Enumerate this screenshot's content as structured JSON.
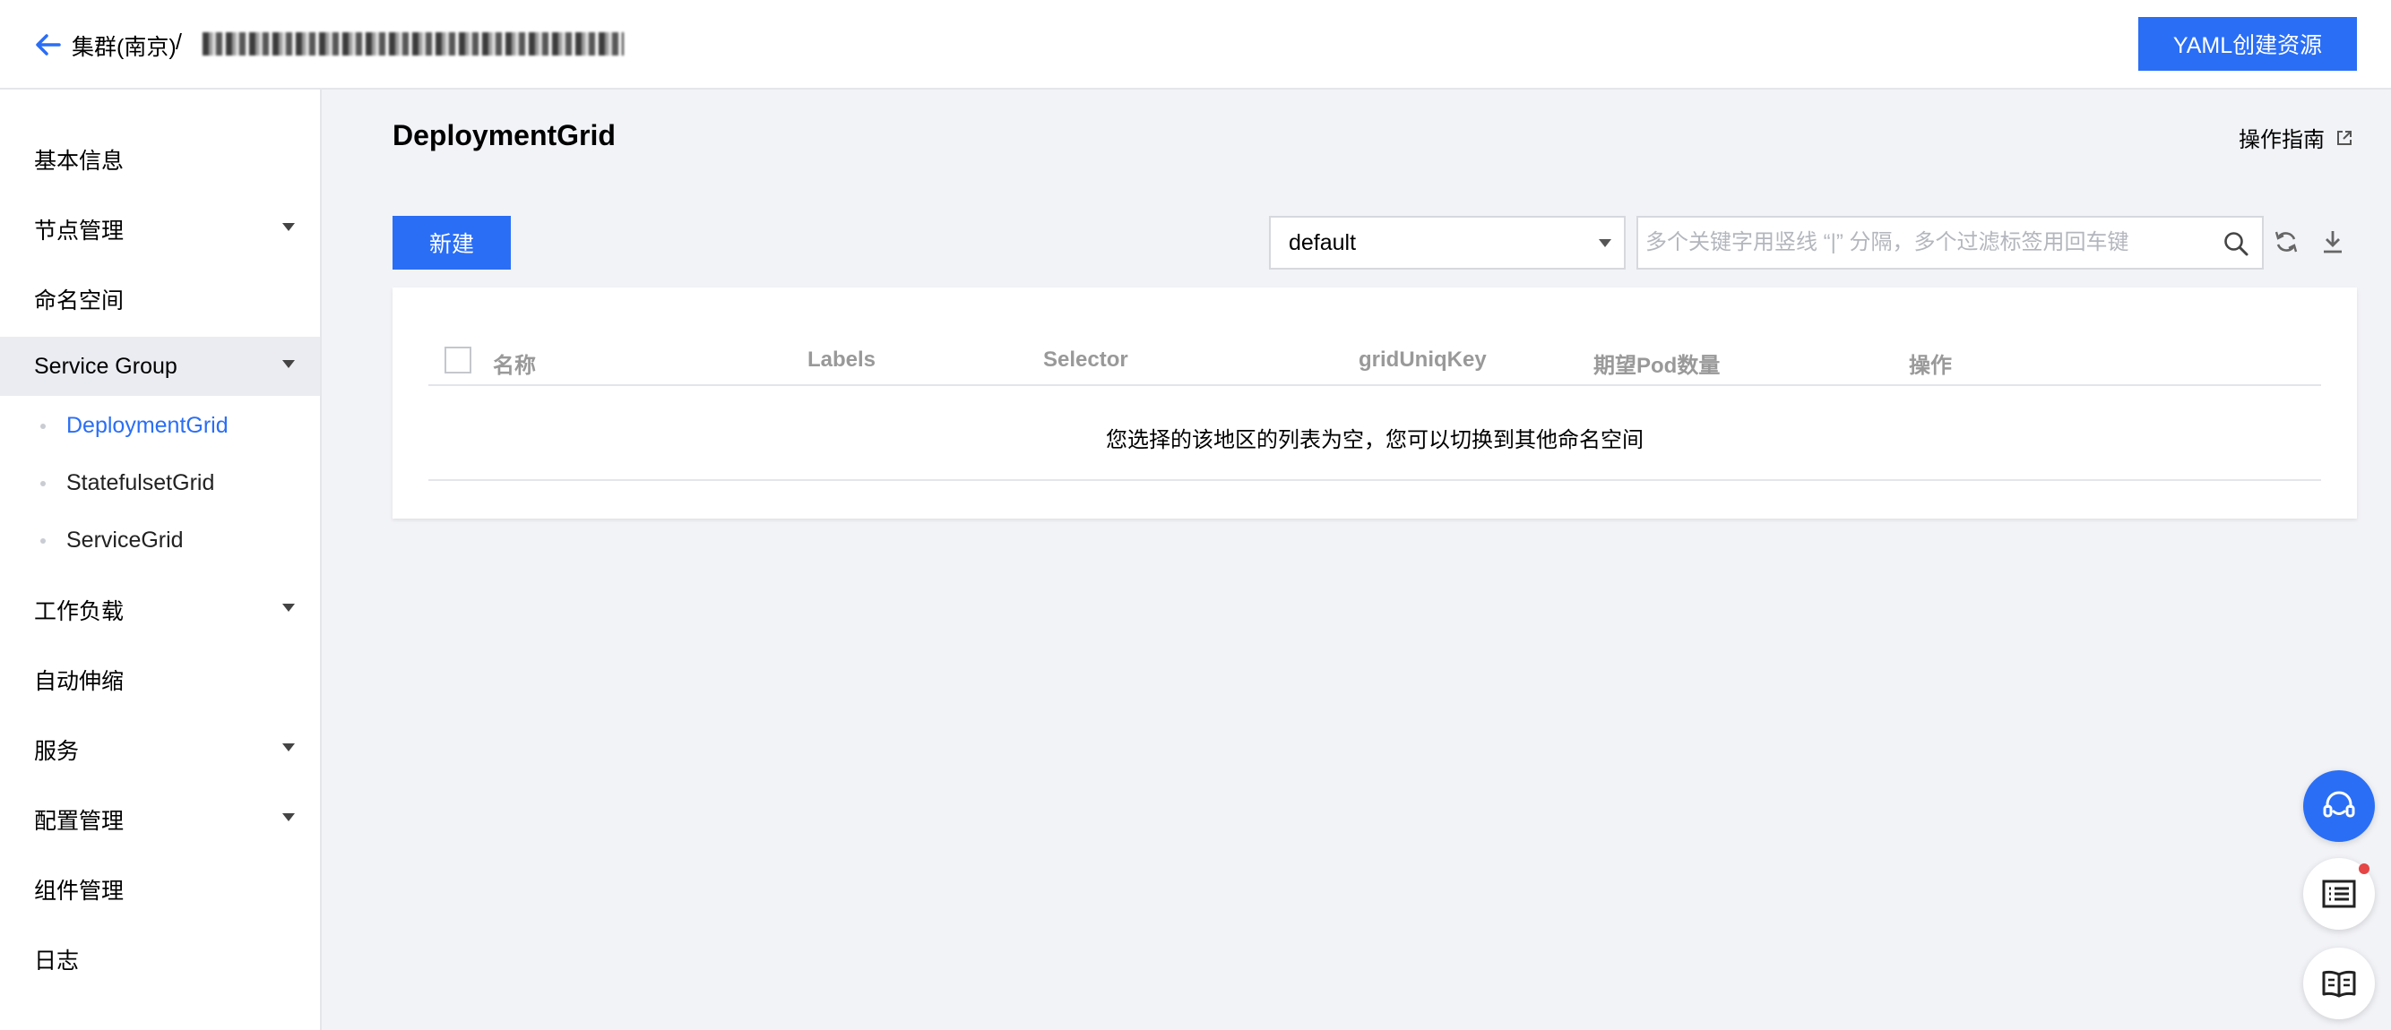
{
  "header": {
    "breadcrumb_cluster": "集群(南京)",
    "breadcrumb_separator": "/",
    "yaml_button_label": "YAML创建资源"
  },
  "sidebar": {
    "items": [
      {
        "label": "基本信息",
        "expandable": false
      },
      {
        "label": "节点管理",
        "expandable": true
      },
      {
        "label": "命名空间",
        "expandable": false
      },
      {
        "label": "Service Group",
        "expandable": true,
        "active": true
      },
      {
        "label": "工作负载",
        "expandable": true
      },
      {
        "label": "自动伸缩",
        "expandable": false
      },
      {
        "label": "服务",
        "expandable": true
      },
      {
        "label": "配置管理",
        "expandable": true
      },
      {
        "label": "组件管理",
        "expandable": false
      },
      {
        "label": "日志",
        "expandable": false
      }
    ],
    "service_group_children": [
      {
        "label": "DeploymentGrid",
        "active": true
      },
      {
        "label": "StatefulsetGrid",
        "active": false
      },
      {
        "label": "ServiceGrid",
        "active": false
      }
    ]
  },
  "main": {
    "title": "DeploymentGrid",
    "guide_link_label": "操作指南",
    "new_button_label": "新建",
    "namespace_selected": "default",
    "search_placeholder": "多个关键字用竖线 “|” 分隔，多个过滤标签用回车键",
    "table": {
      "columns": [
        "名称",
        "Labels",
        "Selector",
        "gridUniqKey",
        "期望Pod数量",
        "操作"
      ],
      "rows": [],
      "empty_message": "您选择的该地区的列表为空，您可以切换到其他命名空间"
    }
  },
  "colors": {
    "primary": "#2a6ef6",
    "background": "#f2f3f7",
    "notification_dot": "#e54545"
  },
  "icons": {
    "back": "arrow-left-icon",
    "external_link": "external-link-icon",
    "search": "search-icon",
    "refresh": "refresh-icon",
    "download": "download-icon",
    "support": "headset-icon",
    "list": "list-icon",
    "book": "book-icon"
  }
}
